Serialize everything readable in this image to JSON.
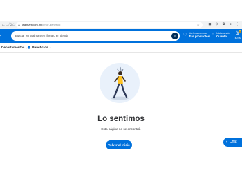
{
  "browser": {
    "back_icon": "back-arrow-icon",
    "forward_icon": "forward-arrow-icon",
    "reload_icon": "reload-icon",
    "home_icon": "home-icon",
    "url_domain": "walmart.com.mx",
    "url_path": "/error-generico"
  },
  "header": {
    "search_placeholder": "Buscar en Walmart en línea o en tienda",
    "reorder_small": "Vuelve a comprar",
    "reorder_big": "Tus productos",
    "account_small": "Iniciar sesión",
    "account_big": "Cuenta",
    "cart_count": "0",
    "cart_total": "$0.00"
  },
  "subnav": {
    "departments": "Departamentos",
    "benefits": "Beneficios"
  },
  "main": {
    "title": "Lo sentimos",
    "subtitle": "Esta página no se encontró.",
    "home_button": "Volver al inicio"
  },
  "chat": {
    "label": "Chat"
  },
  "colors": {
    "brand_blue": "#0071dc",
    "dark_blue": "#002d58",
    "yellow": "#ffc220"
  }
}
